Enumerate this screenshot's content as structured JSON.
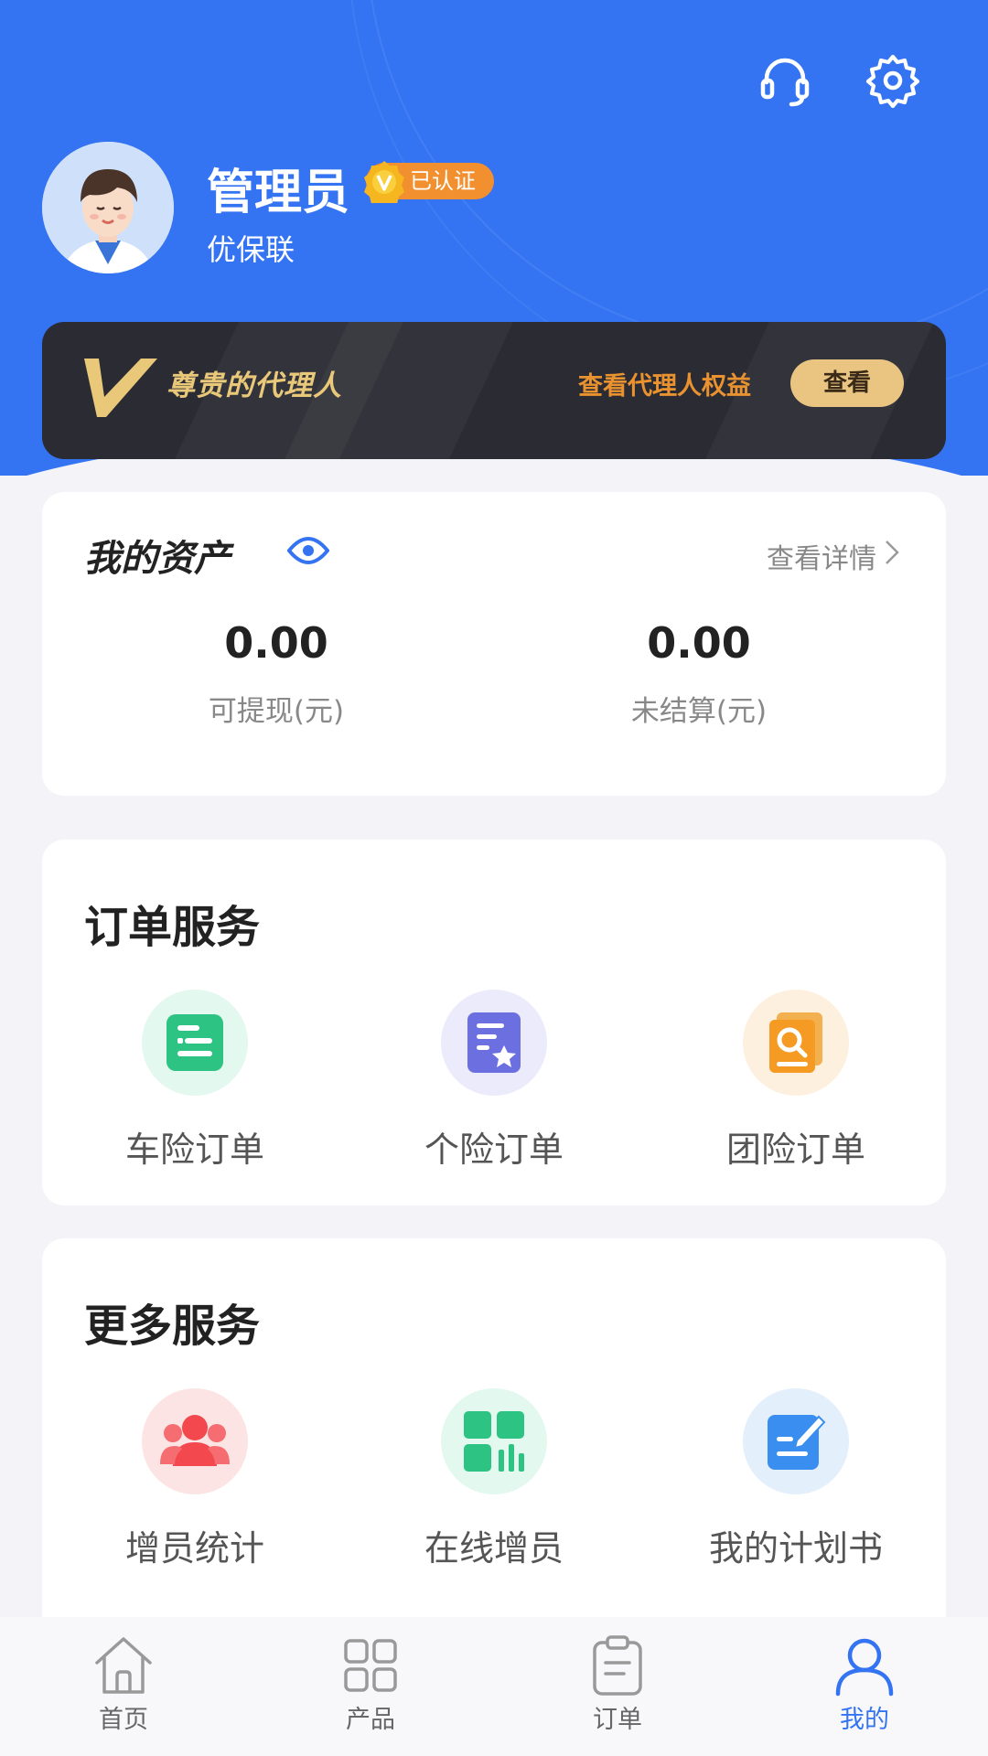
{
  "header": {
    "user_name": "管理员",
    "verified_label": "已认证",
    "org_name": "优保联"
  },
  "vip_banner": {
    "title": "尊贵的代理人",
    "link_text": "查看代理人权益",
    "button_label": "查看"
  },
  "assets": {
    "title": "我的资产",
    "detail_link": "查看详情",
    "items": [
      {
        "value": "0.00",
        "label": "可提现(元)"
      },
      {
        "value": "0.00",
        "label": "未结算(元)"
      }
    ]
  },
  "order_services": {
    "title": "订单服务",
    "items": [
      {
        "label": "车险订单",
        "icon": "car-insurance-order-icon"
      },
      {
        "label": "个险订单",
        "icon": "personal-insurance-order-icon"
      },
      {
        "label": "团险订单",
        "icon": "group-insurance-order-icon"
      }
    ]
  },
  "more_services": {
    "title": "更多服务",
    "items": [
      {
        "label": "增员统计",
        "icon": "recruit-stats-icon"
      },
      {
        "label": "在线增员",
        "icon": "online-recruit-icon"
      },
      {
        "label": "我的计划书",
        "icon": "my-proposal-icon"
      }
    ]
  },
  "tabbar": {
    "items": [
      {
        "label": "首页",
        "icon": "home-icon"
      },
      {
        "label": "产品",
        "icon": "grid-icon"
      },
      {
        "label": "订单",
        "icon": "clipboard-icon"
      },
      {
        "label": "我的",
        "icon": "person-icon"
      }
    ],
    "active_index": 3
  },
  "colors": {
    "primary": "#3474f2",
    "background": "#f3f3f8",
    "vip_gold": "#e9c879",
    "vip_orange": "#e9922f"
  }
}
